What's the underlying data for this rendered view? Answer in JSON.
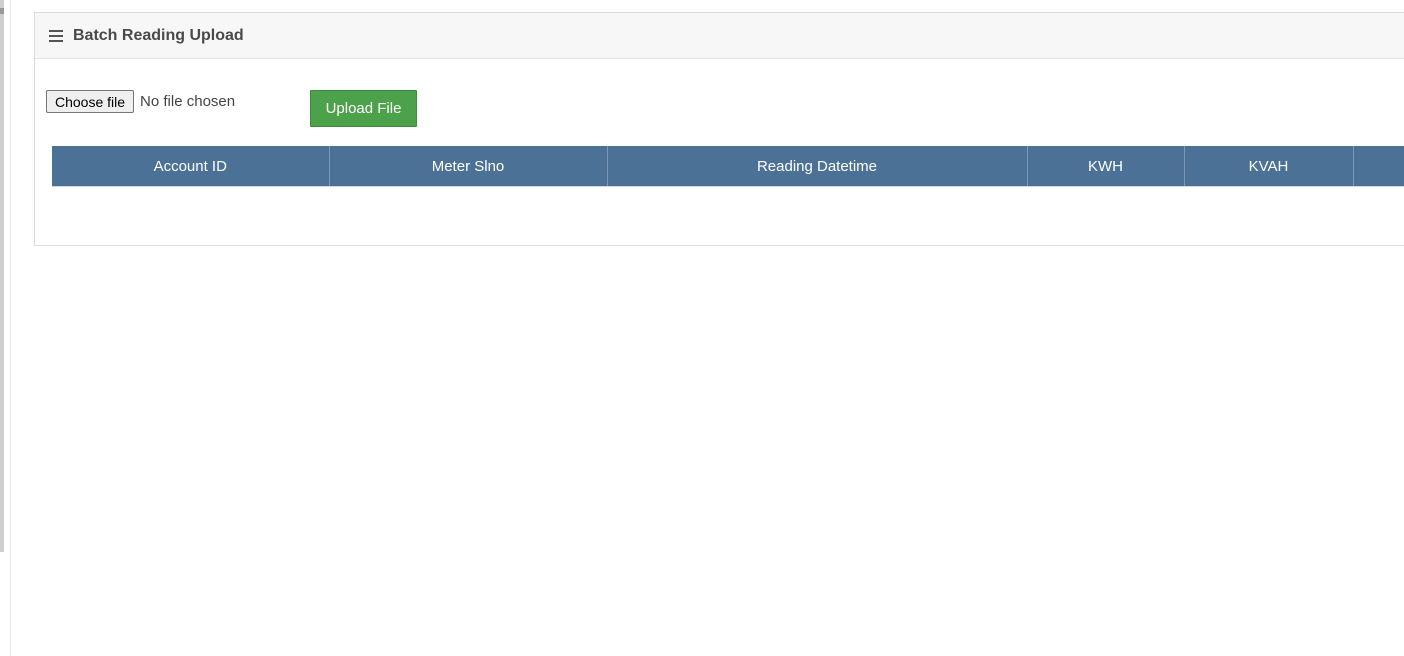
{
  "panel": {
    "title": "Batch Reading Upload"
  },
  "file_input": {
    "button_label": "Choose file",
    "status_text": "No file chosen"
  },
  "upload_button": {
    "label": "Upload File"
  },
  "table": {
    "columns": [
      "Account ID",
      "Meter Slno",
      "Reading Datetime",
      "KWH",
      "KVAH",
      ""
    ]
  },
  "colors": {
    "header_bg": "#4c7196",
    "upload_green": "#4ca14b"
  },
  "icons": {
    "panel_icon": "hamburger-menu-icon"
  }
}
